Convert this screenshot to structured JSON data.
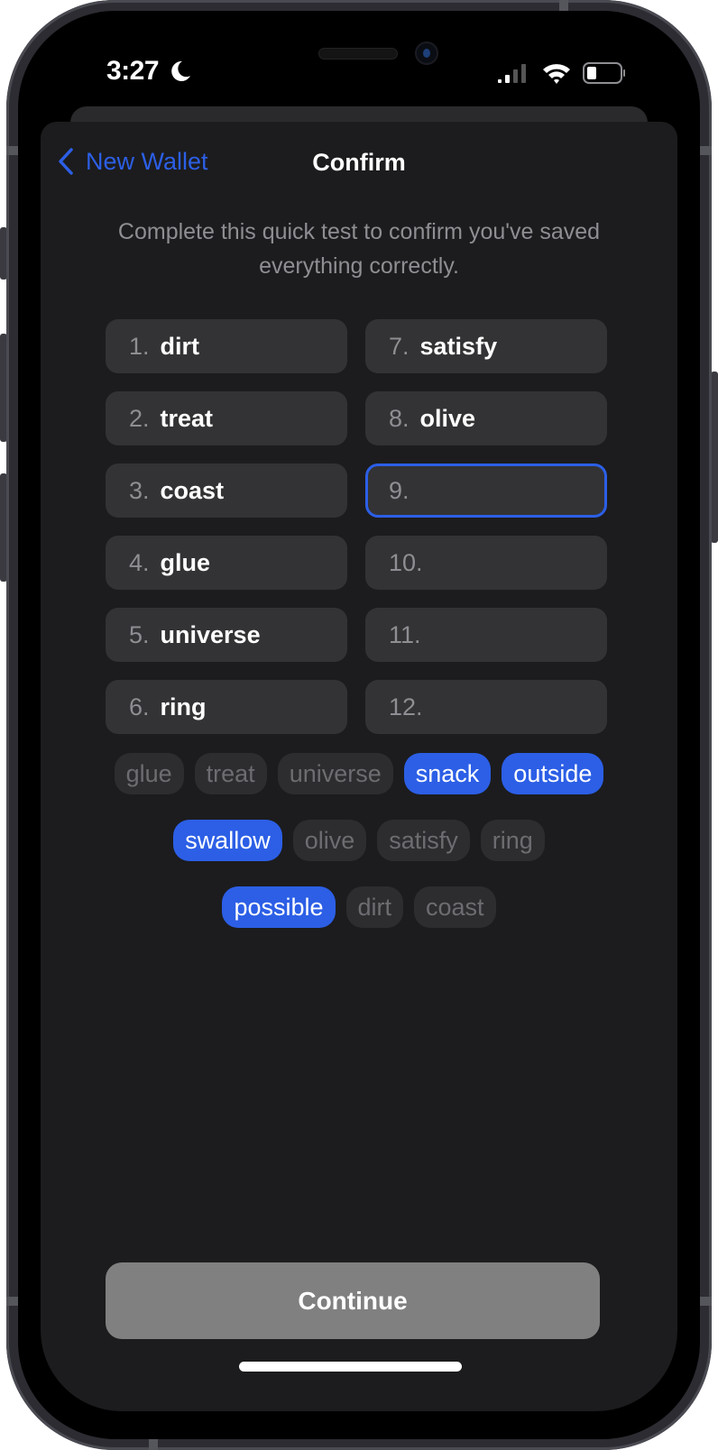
{
  "status_bar": {
    "time": "3:27",
    "focus_icon": "moon-icon",
    "signal_icon": "cellular-signal-icon",
    "wifi_icon": "wifi-icon",
    "battery_icon": "battery-icon"
  },
  "nav": {
    "back_label": "New Wallet",
    "back_icon": "chevron-left-icon",
    "title": "Confirm"
  },
  "subtitle": "Complete this quick test to confirm you've saved everything correctly.",
  "slots": [
    {
      "number": "1.",
      "word": "dirt",
      "active": false
    },
    {
      "number": "2.",
      "word": "treat",
      "active": false
    },
    {
      "number": "3.",
      "word": "coast",
      "active": false
    },
    {
      "number": "4.",
      "word": "glue",
      "active": false
    },
    {
      "number": "5.",
      "word": "universe",
      "active": false
    },
    {
      "number": "6.",
      "word": "ring",
      "active": false
    },
    {
      "number": "7.",
      "word": "satisfy",
      "active": false
    },
    {
      "number": "8.",
      "word": "olive",
      "active": false
    },
    {
      "number": "9.",
      "word": "",
      "active": true
    },
    {
      "number": "10.",
      "word": "",
      "active": false
    },
    {
      "number": "11.",
      "word": "",
      "active": false
    },
    {
      "number": "12.",
      "word": "",
      "active": false
    }
  ],
  "word_bank": [
    [
      {
        "word": "glue",
        "selected": false
      },
      {
        "word": "treat",
        "selected": false
      },
      {
        "word": "universe",
        "selected": false
      },
      {
        "word": "snack",
        "selected": true
      },
      {
        "word": "outside",
        "selected": true
      }
    ],
    [
      {
        "word": "swallow",
        "selected": true
      },
      {
        "word": "olive",
        "selected": false
      },
      {
        "word": "satisfy",
        "selected": false
      },
      {
        "word": "ring",
        "selected": false
      }
    ],
    [
      {
        "word": "possible",
        "selected": true
      },
      {
        "word": "dirt",
        "selected": false
      },
      {
        "word": "coast",
        "selected": false
      }
    ]
  ],
  "continue_label": "Continue",
  "colors": {
    "accent": "#2c5fe6",
    "sheet_background": "#1c1c1e",
    "slot_background": "#333335",
    "chip_background": "#2d2d30",
    "continue_disabled": "#808080"
  }
}
